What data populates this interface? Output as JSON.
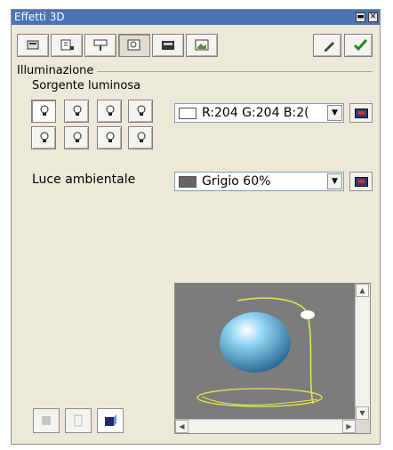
{
  "window": {
    "title": "Effetti 3D",
    "min_glyph": "▬",
    "close_glyph": "✕"
  },
  "toolbar": {
    "items": [
      {
        "name": "geometry",
        "icon": "geometry-icon"
      },
      {
        "name": "shading",
        "icon": "shading-icon"
      },
      {
        "name": "lighting",
        "icon": "lighting-icon"
      },
      {
        "name": "textures",
        "icon": "textures-icon"
      },
      {
        "name": "material",
        "icon": "material-icon"
      },
      {
        "name": "other",
        "icon": "other-icon"
      }
    ],
    "assign_icon": "pencil-icon",
    "apply_icon": "checkmark-icon"
  },
  "lighting": {
    "group_label": "Illuminazione",
    "source_label": "Sorgente luminosa",
    "source_color": {
      "text": "R:204 G:204 B:2(",
      "swatch": "#ffffff"
    },
    "ambient_label": "Luce ambientale",
    "ambient_color": {
      "text": "Grigio 60%",
      "swatch": "#666666"
    }
  },
  "preview": {
    "bg": "#7c7c7c",
    "sphere": "#5fb6e0",
    "wire": "#e8e84a"
  },
  "icons": {
    "bulb": "bulb-icon",
    "color_picker": "color-dialog-icon"
  }
}
